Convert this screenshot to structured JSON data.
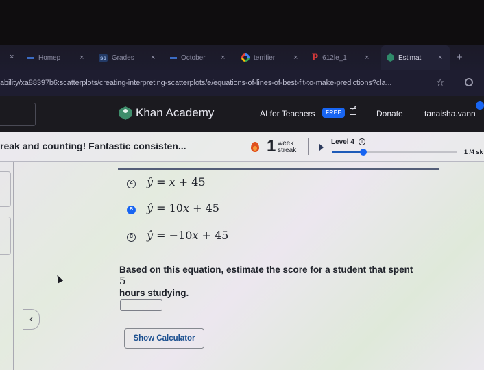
{
  "browser": {
    "tabs": [
      {
        "label": "Homep",
        "favicon": "dash-icon",
        "active": false
      },
      {
        "label": "Grades",
        "favicon": "ss-icon",
        "active": false
      },
      {
        "label": "October",
        "favicon": "dash-icon",
        "active": false
      },
      {
        "label": "terrifier",
        "favicon": "google-icon",
        "active": false
      },
      {
        "label": "612le_1",
        "favicon": "p-icon",
        "active": false
      },
      {
        "label": "Estimati",
        "favicon": "khan-academy-icon",
        "active": true
      }
    ],
    "favicon_ss_text": "ss",
    "favicon_p_text": "P",
    "close_glyph": "×",
    "new_tab_glyph": "+",
    "url": "ability/xa88397b6:scatterplots/creating-interpreting-scatterplots/e/equations-of-lines-of-best-fit-to-make-predictions?cla...",
    "star_glyph": "☆"
  },
  "header": {
    "logo_text": "Khan Academy",
    "ai_for_teachers": "AI for Teachers",
    "free_badge": "FREE",
    "donate": "Donate",
    "username": "tanaisha.vann"
  },
  "streak": {
    "message": "reak and counting! Fantastic consisten...",
    "count": "1",
    "unit_line1": "week",
    "unit_line2": "streak",
    "level_label": "Level 4",
    "info_glyph": "i",
    "progress_fraction": 0.25,
    "skills_text": "1 /4 sk"
  },
  "question": {
    "choices": [
      {
        "letter": "A",
        "hat": "ŷ",
        "rhs_pre": "",
        "var": "x",
        "rhs_post": " + 45",
        "selected": false
      },
      {
        "letter": "B",
        "hat": "ŷ",
        "rhs_pre": "10",
        "var": "x",
        "rhs_post": " + 45",
        "selected": true
      },
      {
        "letter": "C",
        "hat": "ŷ",
        "rhs_pre": "−10",
        "var": "x",
        "rhs_post": " + 45",
        "selected": false
      }
    ],
    "equals": " = ",
    "prompt_text": "Based on this equation, estimate the score for a student that spent ",
    "prompt_number": "5",
    "prompt_tail": "hours studying.",
    "answer_value": "",
    "calculator_label": "Show Calculator",
    "collapse_glyph": "‹"
  }
}
